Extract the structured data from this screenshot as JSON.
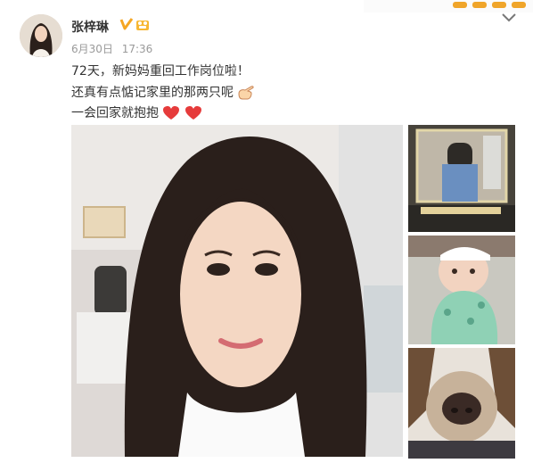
{
  "post": {
    "username": "张梓琳",
    "date": "6月30日",
    "time": "17:36",
    "lines": [
      "72天，新妈妈重回工作岗位啦！",
      "还真有点惦记家里的那两只呢",
      "一会回家就抱抱"
    ]
  },
  "icons": {
    "verified": "verified-v-icon",
    "member": "member-badge-icon",
    "menu": "chevron-down-icon",
    "hand_emoji": "pointing-hand-emoji",
    "heart_emoji": "red-heart-emoji"
  },
  "colors": {
    "verified": "#f5a623",
    "heart": "#e63b3b",
    "meta_text": "#9a9a9a"
  },
  "photos": [
    {
      "role": "main",
      "description_name": "woman-portrait"
    },
    {
      "role": "thumbnail",
      "description_name": "mirror-selfie"
    },
    {
      "role": "thumbnail",
      "description_name": "baby-photo"
    },
    {
      "role": "thumbnail",
      "description_name": "dog-closeup"
    }
  ]
}
